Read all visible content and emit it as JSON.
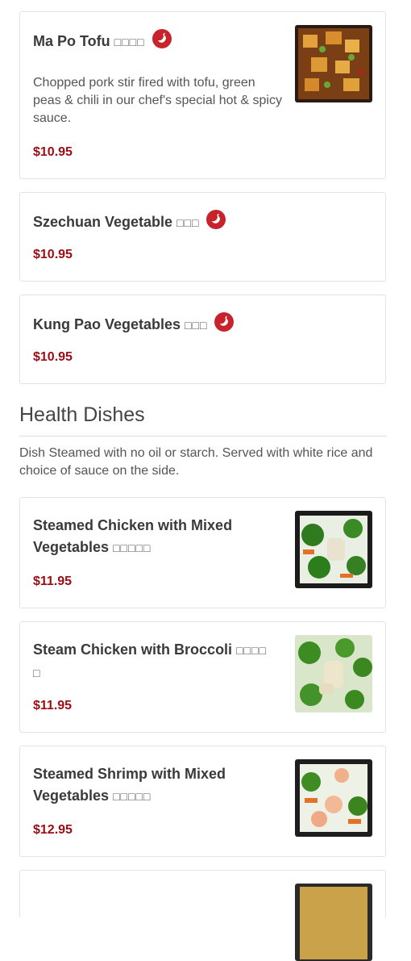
{
  "items_top": [
    {
      "name": "Ma Po Tofu",
      "cjk": "□□□□",
      "desc": "Chopped pork stir fired with tofu, green peas & chili in our chef's special hot & spicy sauce.",
      "price": "$10.95"
    },
    {
      "name": "Szechuan Vegetable",
      "cjk": "□□□",
      "price": "$10.95"
    },
    {
      "name": "Kung Pao Vegetables",
      "cjk": "□□□",
      "price": "$10.95"
    }
  ],
  "section": {
    "title": "Health Dishes",
    "desc": "Dish Steamed with no oil or starch. Served with white rice and choice of sauce on the side."
  },
  "items_health": [
    {
      "line1": "Steamed Chicken with Mixed",
      "line2": "Vegetables",
      "cjk": "□□□□□",
      "price": "$11.95"
    },
    {
      "line1": "Steam Chicken with Broccoli",
      "cjk1": "□□□□",
      "cjk2": "□",
      "price": "$11.95"
    },
    {
      "line1": "Steamed Shrimp with Mixed",
      "line2": "Vegetables",
      "cjk": "□□□□□",
      "price": "$12.95"
    }
  ],
  "colors": {
    "price": "#9b0d12",
    "spicy_badge": "#c8232c"
  },
  "icons": {
    "spicy": "chili-pepper-icon"
  }
}
